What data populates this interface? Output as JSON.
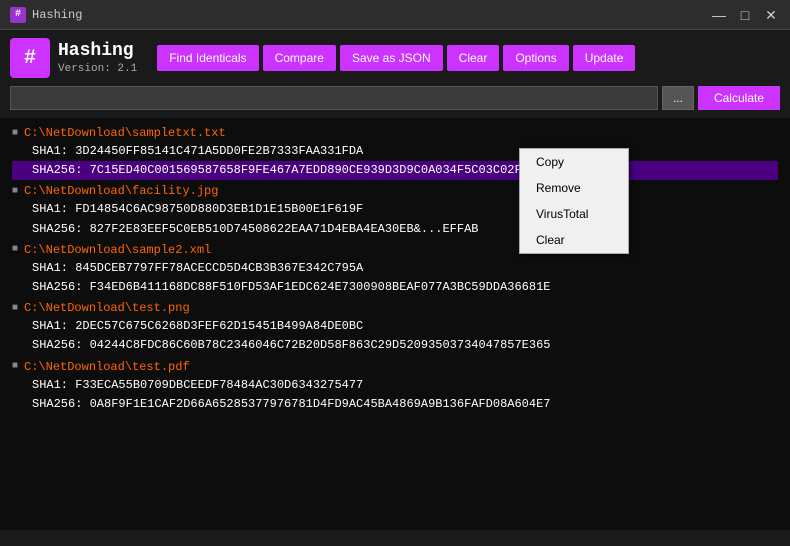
{
  "titlebar": {
    "icon": "#",
    "title": "Hashing",
    "controls": {
      "minimize": "—",
      "maximize": "□",
      "close": "✕"
    }
  },
  "header": {
    "logo": "#",
    "app_name": "Hashing",
    "version": "Version: 2.1",
    "toolbar": {
      "find_identicals": "Find Identicals",
      "compare": "Compare",
      "save_as_json": "Save as JSON",
      "clear": "Clear",
      "options": "Options",
      "update": "Update"
    },
    "search": {
      "placeholder": "",
      "browse_label": "...",
      "calculate_label": "Calculate"
    }
  },
  "files": [
    {
      "path": "C:\\NetDownload\\sampletxt.txt",
      "hashes": [
        {
          "label": "SHA1:",
          "value": "3D24450FF85141C471A5DD0FE2B7333FAA331FDA",
          "selected": false
        },
        {
          "label": "SHA256:",
          "value": "7C15ED40C001569587658F9FE467A7EDD890CE939D3D9C0A034F5C03C02FBB",
          "selected": true
        }
      ]
    },
    {
      "path": "C:\\NetDownload\\facility.jpg",
      "hashes": [
        {
          "label": "SHA1:",
          "value": "FD14854C6AC98750D880D3EB1D1E15B00E1F619F",
          "selected": false
        },
        {
          "label": "SHA256:",
          "value": "827F2E83EEF5C0EB510D74508622EAA71D4EBA4EA30EB&...EFFAB",
          "selected": false
        }
      ]
    },
    {
      "path": "C:\\NetDownload\\sample2.xml",
      "hashes": [
        {
          "label": "SHA1:",
          "value": "845DCEB7797FF78ACECCD5D4CB3B367E342C795A",
          "selected": false
        },
        {
          "label": "SHA256:",
          "value": "F34ED6B411168DC88F510FD53AF1EDC624E7300908BEAF077A3BC59DDA36681E",
          "selected": false
        }
      ]
    },
    {
      "path": "C:\\NetDownload\\test.png",
      "hashes": [
        {
          "label": "SHA1:",
          "value": "2DEC57C675C6268D3FEF62D15451B499A84DE0BC",
          "selected": false
        },
        {
          "label": "SHA256:",
          "value": "04244C8FDC86C60B78C2346046C72B20D58F863C29D52093503734047857E365",
          "selected": false
        }
      ]
    },
    {
      "path": "C:\\NetDownload\\test.pdf",
      "hashes": [
        {
          "label": "SHA1:",
          "value": "F33ECA55B0709DBCEEDF78484AC30D6343275477",
          "selected": false
        },
        {
          "label": "SHA256:",
          "value": "0A8F9F1E1CAF2D66A65285377976781D4FD9AC45BA4869A9B136FAFD08A604E7",
          "selected": false
        }
      ]
    }
  ],
  "context_menu": {
    "items": [
      "Copy",
      "Remove",
      "VirusTotal",
      "Clear"
    ]
  }
}
